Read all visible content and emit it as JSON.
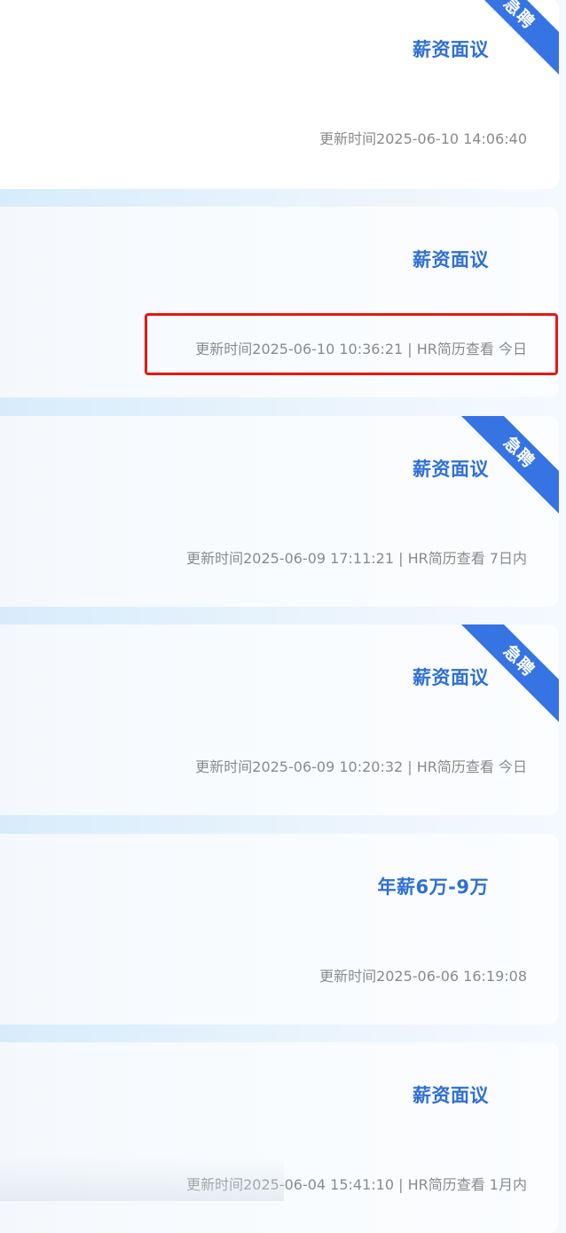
{
  "jobs": [
    {
      "salary": "薪资面议",
      "meta": "更新时间2025-06-10 14:06:40",
      "badge": "急聘"
    },
    {
      "salary": "薪资面议",
      "meta": "更新时间2025-06-10 10:36:21 | HR简历查看 今日",
      "badge": ""
    },
    {
      "salary": "薪资面议",
      "meta": "更新时间2025-06-09 17:11:21 | HR简历查看 7日内",
      "badge": "急聘"
    },
    {
      "salary": "薪资面议",
      "meta": "更新时间2025-06-09 10:20:32 | HR简历查看 今日",
      "badge": "急聘"
    },
    {
      "salary": "年薪6万-9万",
      "meta": "更新时间2025-06-06 16:19:08",
      "badge": ""
    },
    {
      "salary": "薪资面议",
      "meta": "更新时间2025-06-04 15:41:10 | HR简历查看 1月内",
      "badge": ""
    }
  ]
}
